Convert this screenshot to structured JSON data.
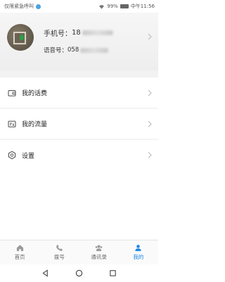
{
  "status_bar": {
    "carrier_text": "仅限紧急呼叫",
    "battery_percent": "99%",
    "time": "中午11:56",
    "battery_level": 0.99
  },
  "profile": {
    "phone_label": "手机号：",
    "phone_visible": "18",
    "voice_label": "语音号：",
    "voice_visible": "058"
  },
  "menu": {
    "items": [
      {
        "label": "我的话费",
        "icon": "wallet-icon"
      },
      {
        "label": "我的流量",
        "icon": "data-card-icon"
      },
      {
        "label": "设置",
        "icon": "settings-hexagon-icon"
      }
    ]
  },
  "tabs": [
    {
      "label": "首页",
      "icon": "home-icon",
      "active": false
    },
    {
      "label": "拨号",
      "icon": "phone-icon",
      "active": false
    },
    {
      "label": "通讯录",
      "icon": "contacts-icon",
      "active": false
    },
    {
      "label": "我的",
      "icon": "person-icon",
      "active": true
    }
  ],
  "colors": {
    "accent": "#1e88e5",
    "text": "#222222",
    "muted": "#666666",
    "band": "#f2f2f2"
  }
}
